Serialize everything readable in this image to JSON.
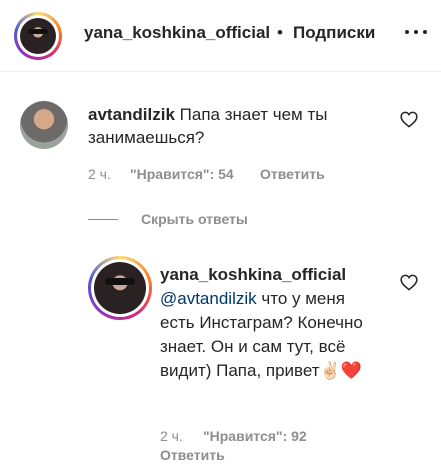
{
  "header": {
    "username": "yana_koshkina_official",
    "separator": "•",
    "follow_label": "Подписки",
    "more_icon": "more-horizontal-icon"
  },
  "comment": {
    "username": "avtandilzik",
    "text": "Папа знает чем ты занимаешься?",
    "time": "2 ч.",
    "likes_label": "\"Нравится\": 54",
    "reply_label": "Ответить",
    "like_icon": "heart-outline-icon"
  },
  "hide_replies_label": "Скрыть ответы",
  "reply": {
    "username": "yana_koshkina_official",
    "mention": "@avtandilzik",
    "text": "что у меня есть Инстаграм? Конечно знает. Он и сам тут, всё видит) Папа, привет",
    "emoji": "✌🏻❤️",
    "time": "2 ч.",
    "likes_label": "\"Нравится\": 92",
    "reply_label": "Ответить",
    "like_icon": "heart-outline-icon"
  },
  "colors": {
    "text": "#262626",
    "secondary": "#8e8e8e",
    "mention": "#00376b",
    "heart": "#ed4956"
  }
}
